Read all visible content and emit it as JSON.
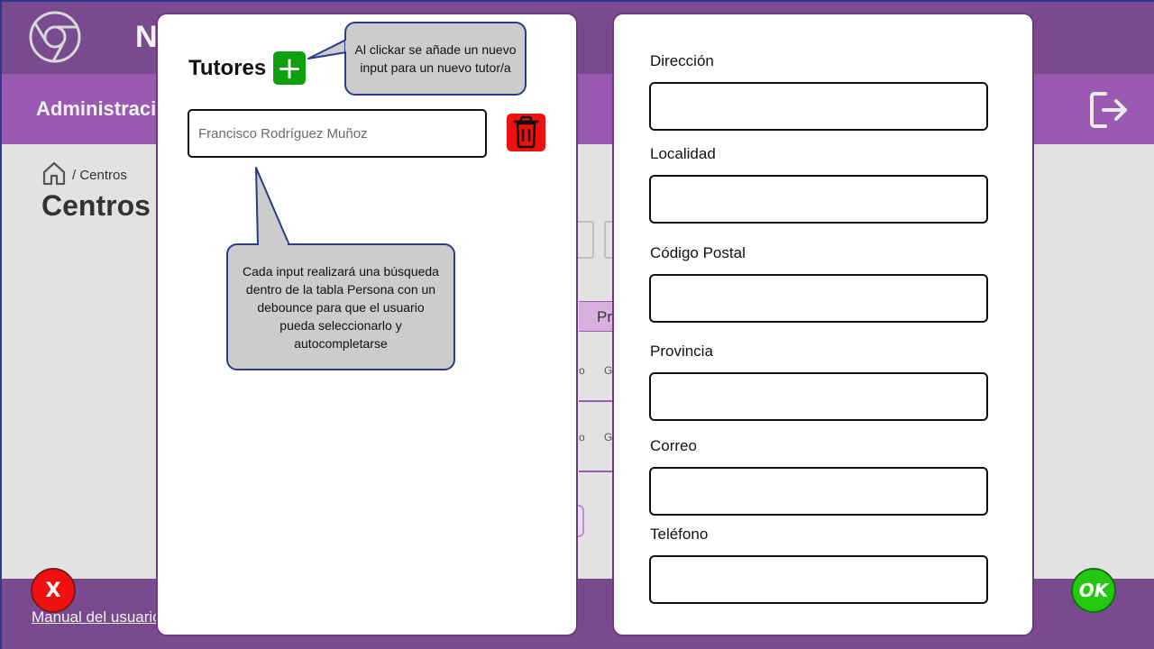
{
  "app": {
    "title": "N",
    "nav_title": "Administracio",
    "breadcrumb": "/ Centros",
    "page_title": "Centros",
    "manual_link": "Manual del usuario",
    "table_header_fragment": "Pr",
    "row_fragments": [
      "o",
      "G"
    ]
  },
  "tutores_panel": {
    "title": "Tutores",
    "add_label": "+",
    "tutor_input_placeholder": "Francisco Rodríguez Muñoz",
    "callout_add": "Al clickar se añade un nuevo input para un nuevo tutor/a",
    "callout_search": "Cada input realizará una búsqueda dentro de la tabla Persona con un debounce para que el usuario pueda seleccionarlo y autocompletarse"
  },
  "address_panel": {
    "fields": [
      {
        "label": "Dirección",
        "value": ""
      },
      {
        "label": "Localidad",
        "value": ""
      },
      {
        "label": "Código Postal",
        "value": ""
      },
      {
        "label": "Provincia",
        "value": ""
      },
      {
        "label": "Correo",
        "value": ""
      },
      {
        "label": "Teléfono",
        "value": ""
      }
    ]
  },
  "actions": {
    "cancel_label": "X",
    "ok_label": "OK"
  },
  "colors": {
    "topbar": "#7a4a8f",
    "navbar": "#9a5ab2",
    "add_button": "#0fa010",
    "delete_button": "#ef1010",
    "ok_button": "#22c90e",
    "cancel_button": "#ef1010"
  }
}
